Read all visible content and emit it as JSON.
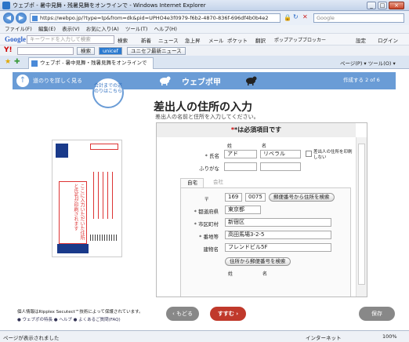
{
  "window": {
    "title": "ウェブポ - 暑中見舞・残暑見舞をオンラインで - Windows Internet Explorer",
    "min": "_",
    "max": "□",
    "close": "×"
  },
  "address": {
    "url": "https://webpo.jp/?type=tp&from=dk&pid=UPHO4e3f0979-f6b2-4870-836f-696df4b0b4e2",
    "search_placeholder": "Google"
  },
  "menu": [
    "ファイル(F)",
    "編集(E)",
    "表示(V)",
    "お気に入り(A)",
    "ツール(T)",
    "ヘルプ(H)"
  ],
  "google_bar": {
    "logo": "Google",
    "placeholder": "キーワードを入力して検索",
    "search": "検索",
    "items": [
      "新着",
      "ニュース",
      "急上昇",
      "メール",
      "ポケット",
      "翻訳",
      "ポップアップブロッカー",
      "設定",
      "ログイン"
    ]
  },
  "yahoo_bar": {
    "logo": "Y!",
    "search": "検索",
    "unicef": "unicef",
    "news": "ユニセフ最新ニュース"
  },
  "tab": {
    "label": "ウェブポ - 暑中見舞・残暑見舞をオンラインで",
    "tools": "ページ(P) ▾  ツール(O) ▾"
  },
  "page": {
    "guide": "道のりを詳しく見る",
    "brand": "ウェブポ甲",
    "step": "作成する 2 of 6",
    "bubble": "合計までの道のりはこちら",
    "title": "差出人の住所の入力",
    "subtitle": "差出人の名前と住所を入力してください。",
    "required": "*は必須項目です",
    "postcard_text": "ここに入力いただいた住所と氏名が印刷されます",
    "form": {
      "sei_label": "姓",
      "mei_label": "名",
      "name_label": "* 氏名",
      "sei": "アド",
      "mei": "リベラル",
      "no_print": "差出人の住所を印刷しない",
      "kana_label": "ふりがな",
      "tab_home": "自宅",
      "tab_company": "会社",
      "zip_label": "〒",
      "zip1": "169",
      "zip2": "0075",
      "zip_btn": "郵便番号から住所を検索",
      "pref_label": "* 都道府県",
      "pref": "東京都",
      "city_label": "* 市区町村",
      "city": "新宿区",
      "banchi_label": "* 番地等",
      "banchi": "高田馬場3-2-5",
      "bldg_label": "建物名",
      "bldg": "フレンドビル5F",
      "addr_btn": "住所から郵便番号を検索",
      "sei2": "姓",
      "mei2": "名"
    },
    "footer_info": "個人情報はRipplex Secutect™技術によって保護されています。",
    "footer_links": "● ウェブポの特長  ● ヘルプ  ● よくあるご質問(FAQ)",
    "back": "もどる",
    "next": "すすむ",
    "save": "保存"
  },
  "status": {
    "text": "ページが表示されました",
    "zone": "インターネット",
    "zoom": "100%"
  }
}
